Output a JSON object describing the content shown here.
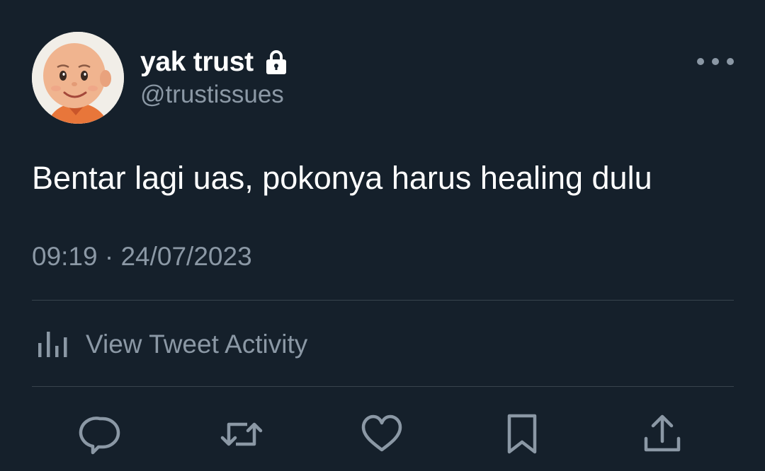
{
  "user": {
    "display_name": "yak trust",
    "handle": "@trustissues",
    "protected_icon": "lock-icon",
    "avatar": "avatar"
  },
  "tweet": {
    "text": "Bentar lagi uas, pokonya harus healing dulu",
    "timestamp": "09:19 · 24/07/2023"
  },
  "activity": {
    "label": "View Tweet Activity",
    "icon": "bar-chart-icon"
  },
  "actions": [
    {
      "name": "reply",
      "icon": "reply-icon"
    },
    {
      "name": "retweet",
      "icon": "retweet-icon"
    },
    {
      "name": "like",
      "icon": "heart-icon"
    },
    {
      "name": "bookmark",
      "icon": "bookmark-icon"
    },
    {
      "name": "share",
      "icon": "share-icon"
    }
  ],
  "colors": {
    "background": "#15202b",
    "text_primary": "#ffffff",
    "text_secondary": "#8b98a5",
    "divider": "#38444d"
  }
}
